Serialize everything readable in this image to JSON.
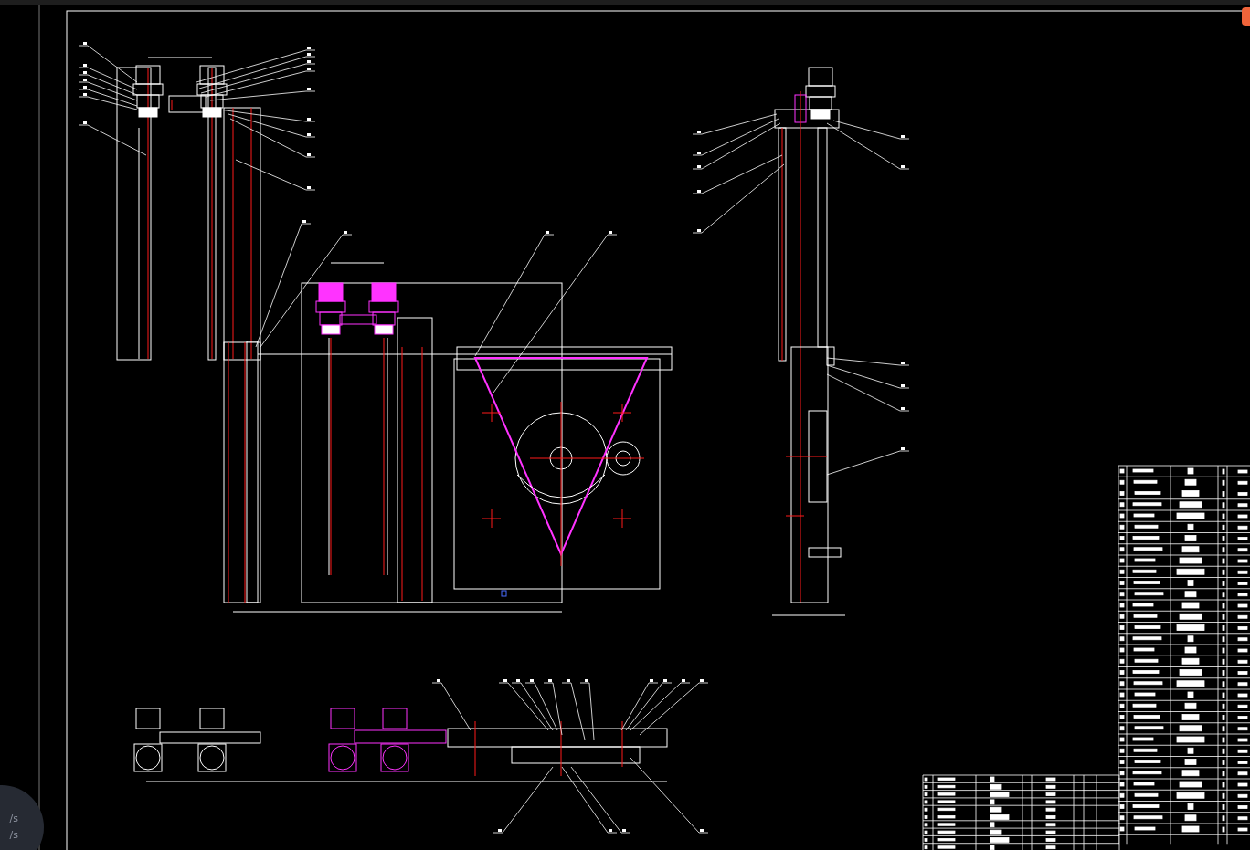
{
  "network_widget": {
    "readings": [
      "/s",
      "/s"
    ]
  }
}
